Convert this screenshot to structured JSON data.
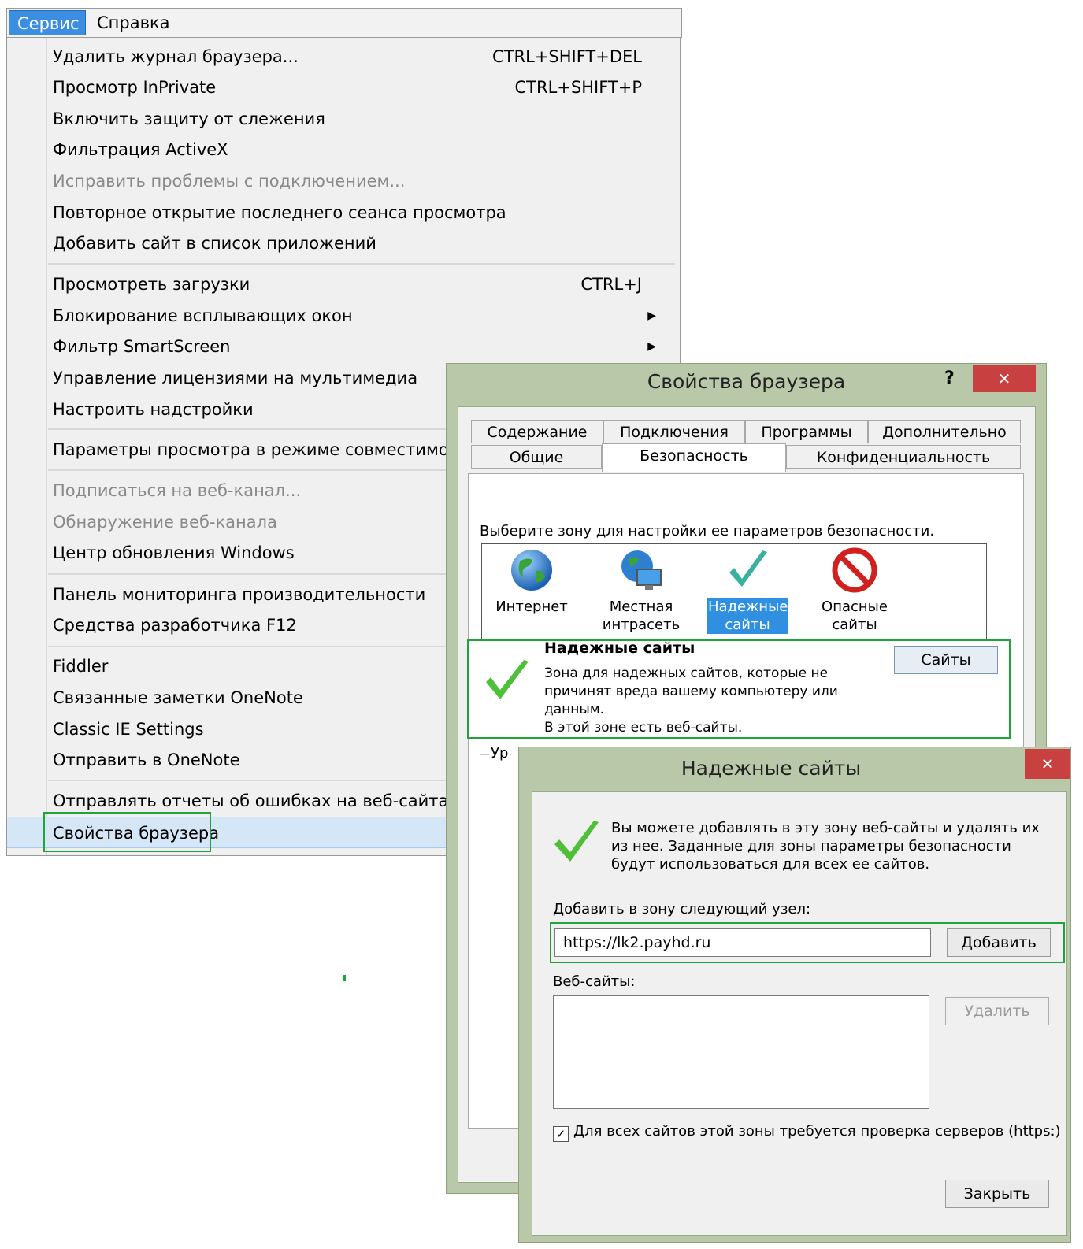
{
  "menubar": {
    "service": "Сервис",
    "help": "Справка"
  },
  "menu": {
    "items": [
      {
        "label": "Удалить журнал браузера...",
        "shortcut": "CTRL+SHIFT+DEL"
      },
      {
        "label": "Просмотр InPrivate",
        "shortcut": "CTRL+SHIFT+P"
      },
      {
        "label": "Включить защиту от слежения"
      },
      {
        "label": "Фильтрация ActiveX"
      },
      {
        "label": "Исправить проблемы с подключением...",
        "disabled": true
      },
      {
        "label": "Повторное открытие последнего сеанса просмотра"
      },
      {
        "label": "Добавить сайт в список приложений"
      },
      {
        "label": "Просмотреть загрузки",
        "shortcut": "CTRL+J"
      },
      {
        "label": "Блокирование всплывающих окон",
        "submenu": true
      },
      {
        "label": "Фильтр SmartScreen",
        "submenu": true
      },
      {
        "label": "Управление лицензиями на мультимедиа"
      },
      {
        "label": "Настроить надстройки"
      },
      {
        "label": "Параметры просмотра в режиме совместимости"
      },
      {
        "label": "Подписаться на веб-канал...",
        "disabled": true
      },
      {
        "label": "Обнаружение веб-канала",
        "disabled": true
      },
      {
        "label": "Центр обновления Windows"
      },
      {
        "label": "Панель мониторинга производительности"
      },
      {
        "label": "Средства разработчика F12"
      },
      {
        "label": "Fiddler"
      },
      {
        "label": "Связанные заметки OneNote"
      },
      {
        "label": "Classic IE Settings"
      },
      {
        "label": "Отправить в OneNote"
      },
      {
        "label": "Отправлять отчеты об ошибках на веб-сайтах"
      },
      {
        "label": "Свойства браузера",
        "selected": true
      }
    ]
  },
  "props_dialog": {
    "title": "Свойства браузера",
    "help": "?",
    "close": "✕",
    "tabs_row1": [
      "Содержание",
      "Подключения",
      "Программы",
      "Дополнительно"
    ],
    "tabs_row2": [
      "Общие",
      "Безопасность",
      "Конфиденциальность"
    ],
    "active_tab": "Безопасность",
    "zone_prompt": "Выберите зону для настройки ее параметров безопасности.",
    "zones": [
      {
        "name": "Интернет",
        "icon": "globe-icon"
      },
      {
        "name": "Местная интрасеть",
        "icon": "intranet-icon"
      },
      {
        "name": "Надежные сайты",
        "icon": "checkmark-icon",
        "selected": true
      },
      {
        "name": "Опасные сайты",
        "icon": "restricted-icon"
      }
    ],
    "zone_title": "Надежные сайты",
    "zone_desc": "Зона для надежных сайтов, которые не причинят вреда вашему компьютеру или данным.",
    "zone_note": "В этой зоне есть веб-сайты.",
    "sites_button": "Сайты",
    "group_label_partial": "Ур"
  },
  "trusted_dialog": {
    "title": "Надежные сайты",
    "close": "✕",
    "description": "Вы можете добавлять в эту зону  веб-сайты и удалять их из нее. Заданные для зоны параметры безопасности будут использоваться для всех ее сайтов.",
    "add_label": "Добавить в зону следующий узел:",
    "add_value": "https://lk2.payhd.ru",
    "add_button": "Добавить",
    "sites_label": "Веб-сайты:",
    "remove_button": "Удалить",
    "https_checkbox": "Для всех сайтов этой зоны требуется проверка серверов (https:)",
    "https_checked": true,
    "close_button": "Закрыть"
  },
  "colors": {
    "highlight_green": "#1fa33a",
    "menu_selected": "#d5e6f7",
    "dialog_frame": "#b8c8a8",
    "close_red": "#c94040",
    "zone_selected": "#2f8fe0"
  }
}
